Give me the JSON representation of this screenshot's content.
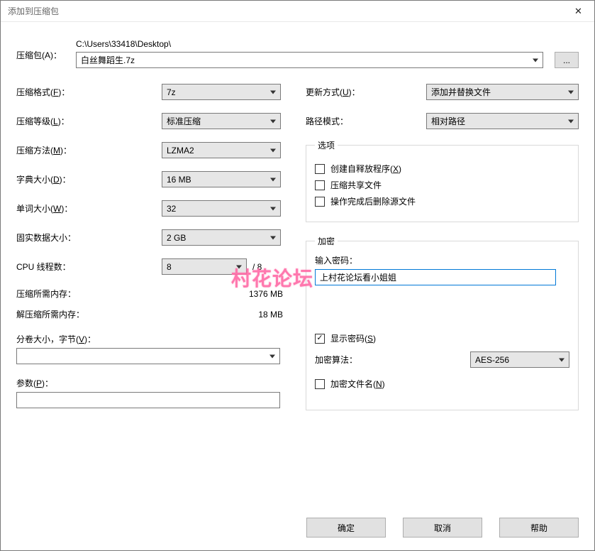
{
  "title": "添加到压缩包",
  "archive": {
    "label": "压缩包(A)：",
    "path": "C:\\Users\\33418\\Desktop\\",
    "filename": "白丝舞蹈生.7z",
    "browse": "..."
  },
  "left": {
    "format_label": "压缩格式(F)：",
    "format": "7z",
    "level_label": "压缩等级(L)：",
    "level": "标准压缩",
    "method_label": "压缩方法(M)：",
    "method": "LZMA2",
    "dict_label": "字典大小(D)：",
    "dict": "16 MB",
    "word_label": "单词大小(W)：",
    "word": "32",
    "solid_label": "固实数据大小：",
    "solid": "2 GB",
    "cpu_label": "CPU 线程数：",
    "cpu": "8",
    "cpu_max": "/ 8",
    "mem_comp_label": "压缩所需内存：",
    "mem_comp": "1376 MB",
    "mem_decomp_label": "解压缩所需内存：",
    "mem_decomp": "18 MB",
    "split_label": "分卷大小，字节(V)：",
    "split": "",
    "params_label": "参数(P)：",
    "params": ""
  },
  "right": {
    "update_label": "更新方式(U)：",
    "update": "添加并替换文件",
    "pathmode_label": "路径模式：",
    "pathmode": "相对路径",
    "options_legend": "选项",
    "opt_sfx": "创建自释放程序(X)",
    "opt_shared": "压缩共享文件",
    "opt_delete": "操作完成后删除源文件",
    "enc_legend": "加密",
    "pwd_label": "输入密码：",
    "pwd_value": "上村花论坛看小姐姐",
    "show_pwd": "显示密码(S)",
    "enc_method_label": "加密算法：",
    "enc_method": "AES-256",
    "enc_names": "加密文件名(N)"
  },
  "buttons": {
    "ok": "确定",
    "cancel": "取消",
    "help": "帮助"
  },
  "watermark": "村花论坛"
}
